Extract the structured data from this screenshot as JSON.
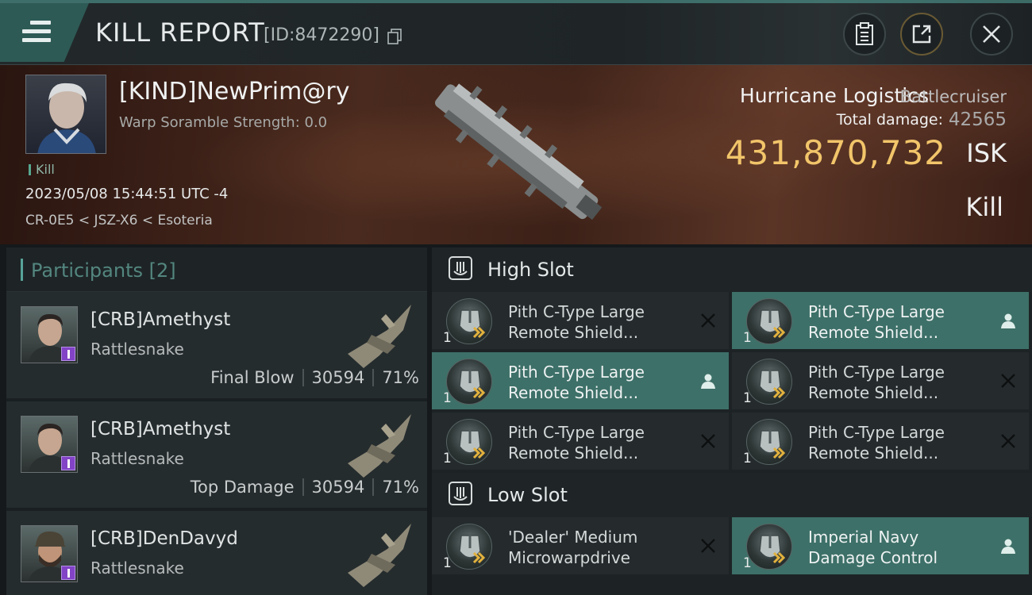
{
  "header": {
    "title": "KILL REPORT",
    "report_id": "[ID:8472290]",
    "menu_icon": "hamburger-icon",
    "buttons": [
      {
        "icon": "clipboard-icon"
      },
      {
        "icon": "share-icon"
      },
      {
        "icon": "close-icon"
      }
    ]
  },
  "victim": {
    "name": "[KIND]NewPrim@ry",
    "warp_scramble": "Warp Soramble Strength: 0.0",
    "kill_tag": "Kill",
    "datetime": "2023/05/08 15:44:51 UTC -4",
    "location": "CR-0E5 < JSZ-X6 < Esoteria",
    "ship_name": "Hurricane Logistics",
    "ship_class": "Battlecruiser",
    "total_damage_label": "Total damage:",
    "total_damage_value": "42565",
    "isk_value": "431,870,732",
    "isk_unit": "ISK",
    "result": "Kill"
  },
  "participants": {
    "title": "Participants [2]",
    "rows": [
      {
        "name": "[CRB]Amethyst",
        "ship": "Rattlesnake",
        "role": "Final Blow",
        "damage": "30594",
        "percent": "71%"
      },
      {
        "name": "[CRB]Amethyst",
        "ship": "Rattlesnake",
        "role": "Top Damage",
        "damage": "30594",
        "percent": "71%"
      },
      {
        "name": "[CRB]DenDavyd",
        "ship": "Rattlesnake"
      }
    ]
  },
  "high_slot": {
    "title": "High Slot",
    "modules": [
      {
        "line1": "Pith C-Type Large",
        "line2": "Remote Shield...",
        "qty": "1",
        "status": "destroyed",
        "highlight": false
      },
      {
        "line1": "Pith C-Type Large",
        "line2": "Remote Shield...",
        "qty": "1",
        "status": "dropped",
        "highlight": true
      },
      {
        "line1": "Pith C-Type Large",
        "line2": "Remote Shield...",
        "qty": "1",
        "status": "dropped",
        "highlight": true
      },
      {
        "line1": "Pith C-Type Large",
        "line2": "Remote Shield...",
        "qty": "1",
        "status": "destroyed",
        "highlight": false
      },
      {
        "line1": "Pith C-Type Large",
        "line2": "Remote Shield...",
        "qty": "1",
        "status": "destroyed",
        "highlight": false
      },
      {
        "line1": "Pith C-Type Large",
        "line2": "Remote Shield...",
        "qty": "1",
        "status": "destroyed",
        "highlight": false
      }
    ]
  },
  "low_slot": {
    "title": "Low Slot",
    "modules": [
      {
        "line1": "'Dealer' Medium",
        "line2": "Microwarpdrive",
        "qty": "1",
        "status": "destroyed",
        "highlight": false
      },
      {
        "line1": "Imperial Navy",
        "line2": "Damage Control",
        "qty": "1",
        "status": "dropped",
        "highlight": true
      }
    ]
  },
  "colors": {
    "accent": "#3d7068",
    "isk": "#f2c56a",
    "hero": "#4a2a1e"
  }
}
